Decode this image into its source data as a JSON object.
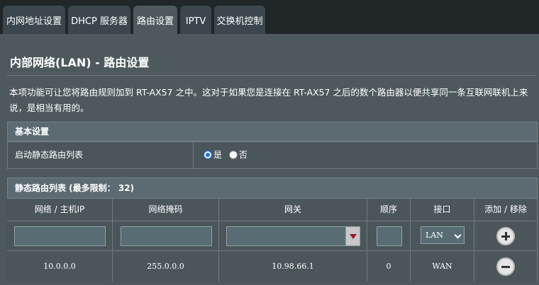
{
  "tabs": [
    {
      "label": "内网地址设置"
    },
    {
      "label": "DHCP 服务器"
    },
    {
      "label": "路由设置"
    },
    {
      "label": "IPTV"
    },
    {
      "label": "交换机控制"
    }
  ],
  "page": {
    "title": "内部网络(LAN) - 路由设置",
    "description": "本项功能可让您将路由规则加到 RT-AX57 之中。这对于如果您是连接在 RT-AX57 之后的数个路由器以便共享同一条互联网联机上来说，是相当有用的。"
  },
  "basic": {
    "header": "基本设置",
    "static_route_label": "启动静态路由列表",
    "yes_label": "是",
    "no_label": "否",
    "selected": "是"
  },
  "routes": {
    "header": "静态路由列表 (最多限制： 32)",
    "columns": [
      "网络 / 主机IP",
      "网络掩码",
      "网关",
      "顺序",
      "接口",
      "添加 / 移除"
    ],
    "input_row": {
      "interface": "LAN"
    },
    "rows": [
      {
        "network": "10.0.0.0",
        "netmask": "255.0.0.0",
        "gateway": "10.98.66.1",
        "metric": "0",
        "interface": "WAN"
      }
    ]
  },
  "colors": {
    "panel": "#4d595d",
    "background": "#212629",
    "accent_red": "#a0102a"
  }
}
